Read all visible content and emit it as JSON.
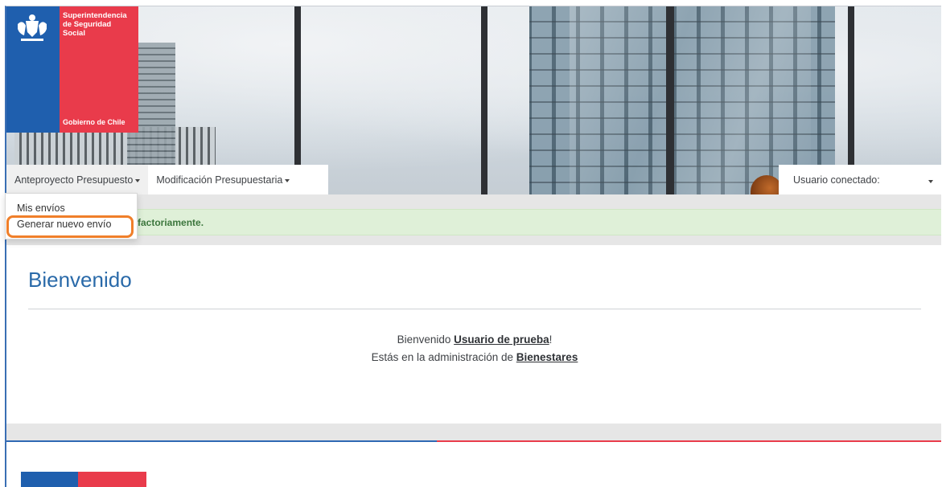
{
  "logo": {
    "org_name": "Superintendencia de Seguridad Social",
    "gov_name": "Gobierno de Chile"
  },
  "navbar": {
    "items": [
      {
        "label": "Anteproyecto Presupuesto"
      },
      {
        "label": "Modificación Presupuestaria"
      }
    ],
    "user_label": "Usuario conectado:"
  },
  "dropdown": {
    "items": [
      {
        "label": "Mis envíos"
      },
      {
        "label": "Generar nuevo envío"
      }
    ]
  },
  "alert": {
    "visible_text": "factoriamente."
  },
  "main": {
    "title": "Bienvenido",
    "welcome_prefix": "Bienvenido ",
    "user_name": "Usuario de prueba",
    "welcome_suffix": "!",
    "admin_prefix": "Estás en la administración de ",
    "admin_entity": "Bienestares"
  },
  "colors": {
    "brand_blue": "#1f5fae",
    "brand_red": "#e93b4b",
    "title_blue": "#2a6aa9",
    "alert_bg": "#dff0d8",
    "alert_text": "#3c763d",
    "highlight": "#f07f2a"
  }
}
